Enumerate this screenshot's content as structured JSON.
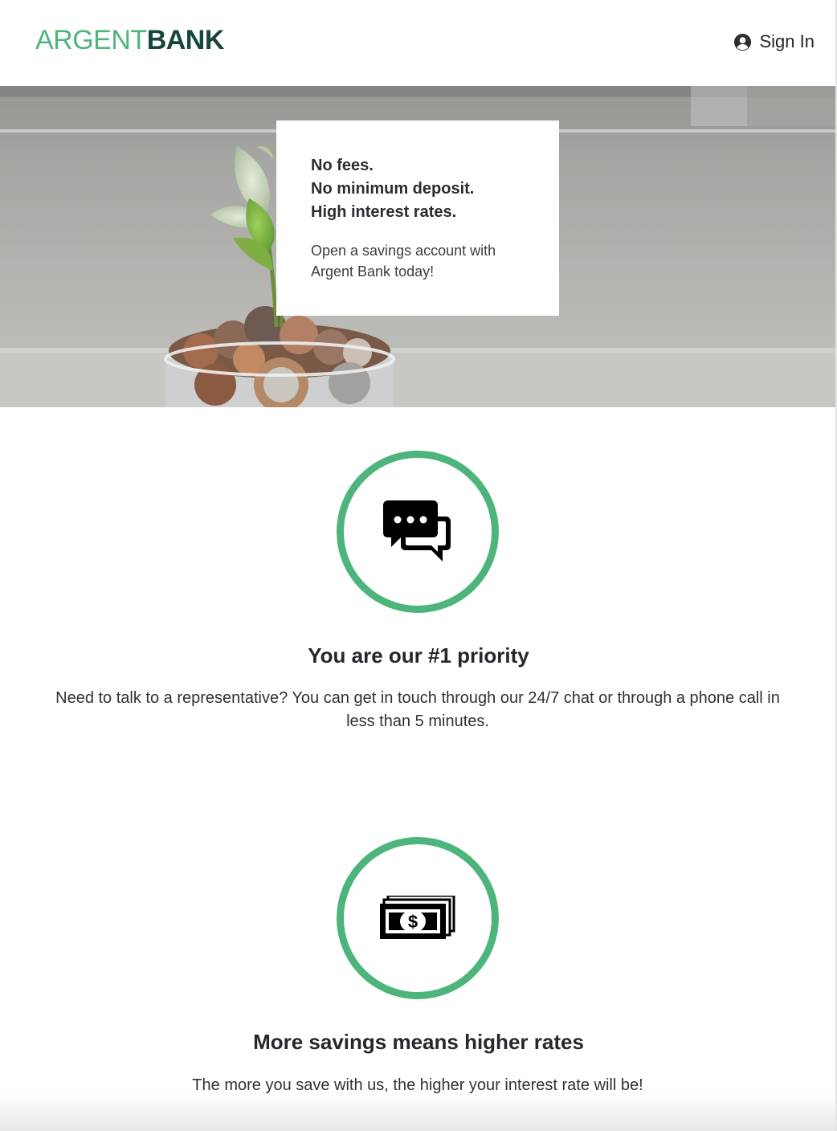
{
  "header": {
    "logo_part1": "ARGENT",
    "logo_part2": "BANK",
    "signin_label": "Sign In",
    "signin_icon": "user-circle-icon"
  },
  "hero": {
    "image": "plant-growing-from-coins-in-jar",
    "promo_lines": [
      "No fees.",
      "No minimum deposit.",
      "High interest rates."
    ],
    "promo_sub": "Open a savings account with Argent Bank today!"
  },
  "features": [
    {
      "icon": "chat-bubbles-icon",
      "title": "You are our #1 priority",
      "text": "Need to talk to a representative? You can get in touch through our 24/7 chat or through a phone call in less than 5 minutes."
    },
    {
      "icon": "money-stack-icon",
      "title": "More savings means higher rates",
      "text": "The more you save with us, the higher your interest rate will be!"
    }
  ],
  "colors": {
    "brand_green": "#4db57b",
    "brand_dark": "#17463a"
  }
}
